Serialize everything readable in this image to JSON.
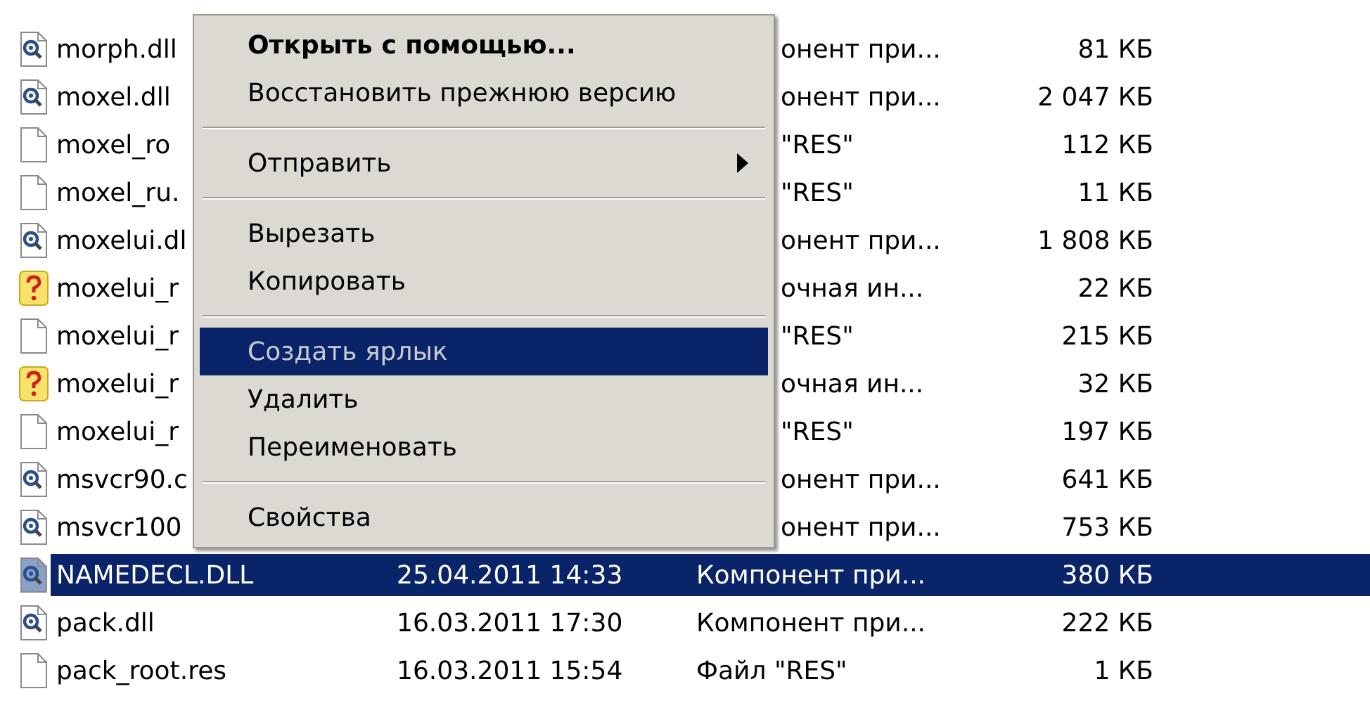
{
  "files": [
    {
      "kind": "dll",
      "name": "morph.dll",
      "type": "онент при...",
      "size": "81 КБ",
      "selected": false
    },
    {
      "kind": "dll",
      "name": "moxel.dll",
      "type": "онент при...",
      "size": "2 047 КБ",
      "selected": false
    },
    {
      "kind": "blank",
      "name": "moxel_ro",
      "type": "\"RES\"",
      "size": "112 КБ",
      "selected": false
    },
    {
      "kind": "blank",
      "name": "moxel_ru.",
      "type": "\"RES\"",
      "size": "11 КБ",
      "selected": false
    },
    {
      "kind": "dll",
      "name": "moxelui.dl",
      "type": "онент при...",
      "size": "1 808 КБ",
      "selected": false
    },
    {
      "kind": "help",
      "name": "moxelui_r",
      "type": "очная ин...",
      "size": "22 КБ",
      "selected": false
    },
    {
      "kind": "blank",
      "name": "moxelui_r",
      "type": "\"RES\"",
      "size": "215 КБ",
      "selected": false
    },
    {
      "kind": "help",
      "name": "moxelui_r",
      "type": "очная ин...",
      "size": "32 КБ",
      "selected": false
    },
    {
      "kind": "blank",
      "name": "moxelui_r",
      "type": "\"RES\"",
      "size": "197 КБ",
      "selected": false
    },
    {
      "kind": "dll",
      "name": "msvcr90.c",
      "type": "онент при...",
      "size": "641 КБ",
      "selected": false
    },
    {
      "kind": "dll",
      "name": "msvcr100",
      "type": "онент при...",
      "size": "753 КБ",
      "selected": false
    },
    {
      "kind": "dll",
      "name": "NAMEDECL.DLL",
      "date": "25.04.2011 14:33",
      "type": "Компонент при...",
      "size": "380 КБ",
      "selected": true
    },
    {
      "kind": "dll",
      "name": "pack.dll",
      "date": "16.03.2011 17:30",
      "type": "Компонент при...",
      "size": "222 КБ",
      "selected": false
    },
    {
      "kind": "blank",
      "name": "pack_root.res",
      "date": "16.03.2011 15:54",
      "type": "Файл \"RES\"",
      "size": "1 КБ",
      "selected": false
    }
  ],
  "context_menu": [
    {
      "kind": "item",
      "label": "Открыть с помощью...",
      "default": true,
      "submenu": false,
      "selected": false
    },
    {
      "kind": "item",
      "label": "Восстановить прежнюю версию",
      "default": false,
      "submenu": false,
      "selected": false
    },
    {
      "kind": "separator"
    },
    {
      "kind": "item",
      "label": "Отправить",
      "default": false,
      "submenu": true,
      "selected": false
    },
    {
      "kind": "separator"
    },
    {
      "kind": "item",
      "label": "Вырезать",
      "default": false,
      "submenu": false,
      "selected": false
    },
    {
      "kind": "item",
      "label": "Копировать",
      "default": false,
      "submenu": false,
      "selected": false
    },
    {
      "kind": "separator"
    },
    {
      "kind": "item",
      "label": "Создать ярлык",
      "default": false,
      "submenu": false,
      "selected": true
    },
    {
      "kind": "item",
      "label": "Удалить",
      "default": false,
      "submenu": false,
      "selected": false
    },
    {
      "kind": "item",
      "label": "Переименовать",
      "default": false,
      "submenu": false,
      "selected": false
    },
    {
      "kind": "separator"
    },
    {
      "kind": "item",
      "label": "Свойства",
      "default": false,
      "submenu": false,
      "selected": false
    }
  ]
}
